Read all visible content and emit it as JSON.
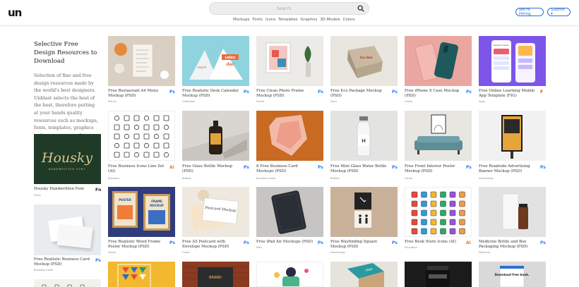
{
  "header": {
    "logo": "un",
    "search_placeholder": "Search",
    "nav": [
      "Mockups",
      "Fonts",
      "Icons",
      "Templates",
      "Graphics",
      "3D Models",
      "Colors"
    ],
    "hiring_label": "We're Hiring",
    "submit_label": "Submit ▾"
  },
  "sidebar": {
    "title": "Selective Free Design Resources to Download",
    "description": "Selection of fine and free design resources made by the world's best designers. Unblast selects the best of the best, therefore putting at your hands quality resources such as mockups, fonts, templates, graphics and save you tons of searching hours.",
    "cards": [
      {
        "title": "Housky Handwritten Font",
        "category": "Fonts",
        "badge": "Fn"
      },
      {
        "title": "Free Realistic Business Card Mockup (PSD)",
        "category": "Business Cards",
        "badge": "Ps"
      }
    ]
  },
  "grid": {
    "rows": [
      [
        {
          "title": "Free Restaurant A4 Menu Mockup (PSD)",
          "category": "Menus",
          "badge": "Ps"
        },
        {
          "title": "Free Realistic Desk Calendar Mockup (PSD)",
          "category": "Calendars",
          "badge": "Ps"
        },
        {
          "title": "Free Clean Photo Frame Mockup (PSD)",
          "category": "Frame",
          "badge": "Ps"
        },
        {
          "title": "Free Eco Package Mockup (PSD)",
          "category": "Food",
          "badge": "Ps"
        },
        {
          "title": "Free iPhone X Case Mockup (PSD)",
          "category": "Cases",
          "badge": "Ps"
        },
        {
          "title": "Free Online Learning Mobile App Template (FIG)",
          "category": "Apps",
          "badge": "F"
        }
      ],
      [
        {
          "title": "Free Business Icons Line Set (AI)",
          "category": "Business",
          "badge": "Ai"
        },
        {
          "title": "Free Glass Bottle Mockup (PSD)",
          "category": "Bottles",
          "badge": "Ps"
        },
        {
          "title": "8 Free Business Card Mockups (PSD)",
          "category": "Business Cards",
          "badge": "Ps"
        },
        {
          "title": "Free Mini Glass Water Bottle Mockup (PSD)",
          "category": "Bottles",
          "badge": "Ps"
        },
        {
          "title": "Free Front Interior Poster Mockup (PSD)",
          "category": "Frame",
          "badge": "Ps"
        },
        {
          "title": "Free Roadside Advertising Banner Mockup (PSD)",
          "category": "Advertising",
          "badge": "Ps"
        }
      ],
      [
        {
          "title": "Free Realistic Wood Frame Poster Mockup (PSD)",
          "category": "Frame",
          "badge": "Ps"
        },
        {
          "title": "Free A5 Postcard with Envelope Mockup (PSD)",
          "category": "Cards",
          "badge": "Ps"
        },
        {
          "title": "Free iPad Air Mockups (PSD)",
          "category": "iPad",
          "badge": "Ps"
        },
        {
          "title": "Free Wayfinding Square Mockup (PSD)",
          "category": "Advertising",
          "badge": "Ps"
        },
        {
          "title": "Free Book Store Icons (AI)",
          "category": "Education",
          "badge": "Ai"
        },
        {
          "title": "Medicine Bottle and Box Packaging Mockup (PSD)",
          "category": "Medicine",
          "badge": "Ps"
        }
      ]
    ]
  },
  "art": {
    "calendar_top": "calen",
    "calendar_mid": "dar",
    "calendar_month": "march",
    "font_sample": "Housky",
    "font_sample_sub": "HANDWRITTEN FONT",
    "postcard_text": "Postcard Mockup",
    "poster_top": "POSTER",
    "poster_mid": "FRAME",
    "poster_low": "MOCKUP",
    "box_text": "Eco Box",
    "book_text": "Download free book.",
    "brick_text": "BRAND",
    "bottle_label": "H",
    "bag_text": "FREE",
    "app_text": "Popular Courses"
  }
}
